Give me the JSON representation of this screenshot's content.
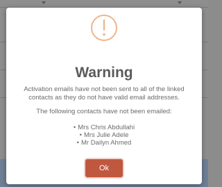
{
  "dialog": {
    "title": "Warning",
    "icon": "exclamation-circle-icon",
    "icon_color": "#f0b48a",
    "message": "Activation emails have not been sent to all of the linked contacts as they do not have valid email addresses.",
    "subtitle": "The following contacts have not been emailed:",
    "contacts": [
      "Mrs Chris Abdullahi",
      "Mrs Julie Adele",
      "Mr Dailyn Ahmed"
    ],
    "ok_label": "Ok",
    "ok_color": "#c0583f"
  }
}
